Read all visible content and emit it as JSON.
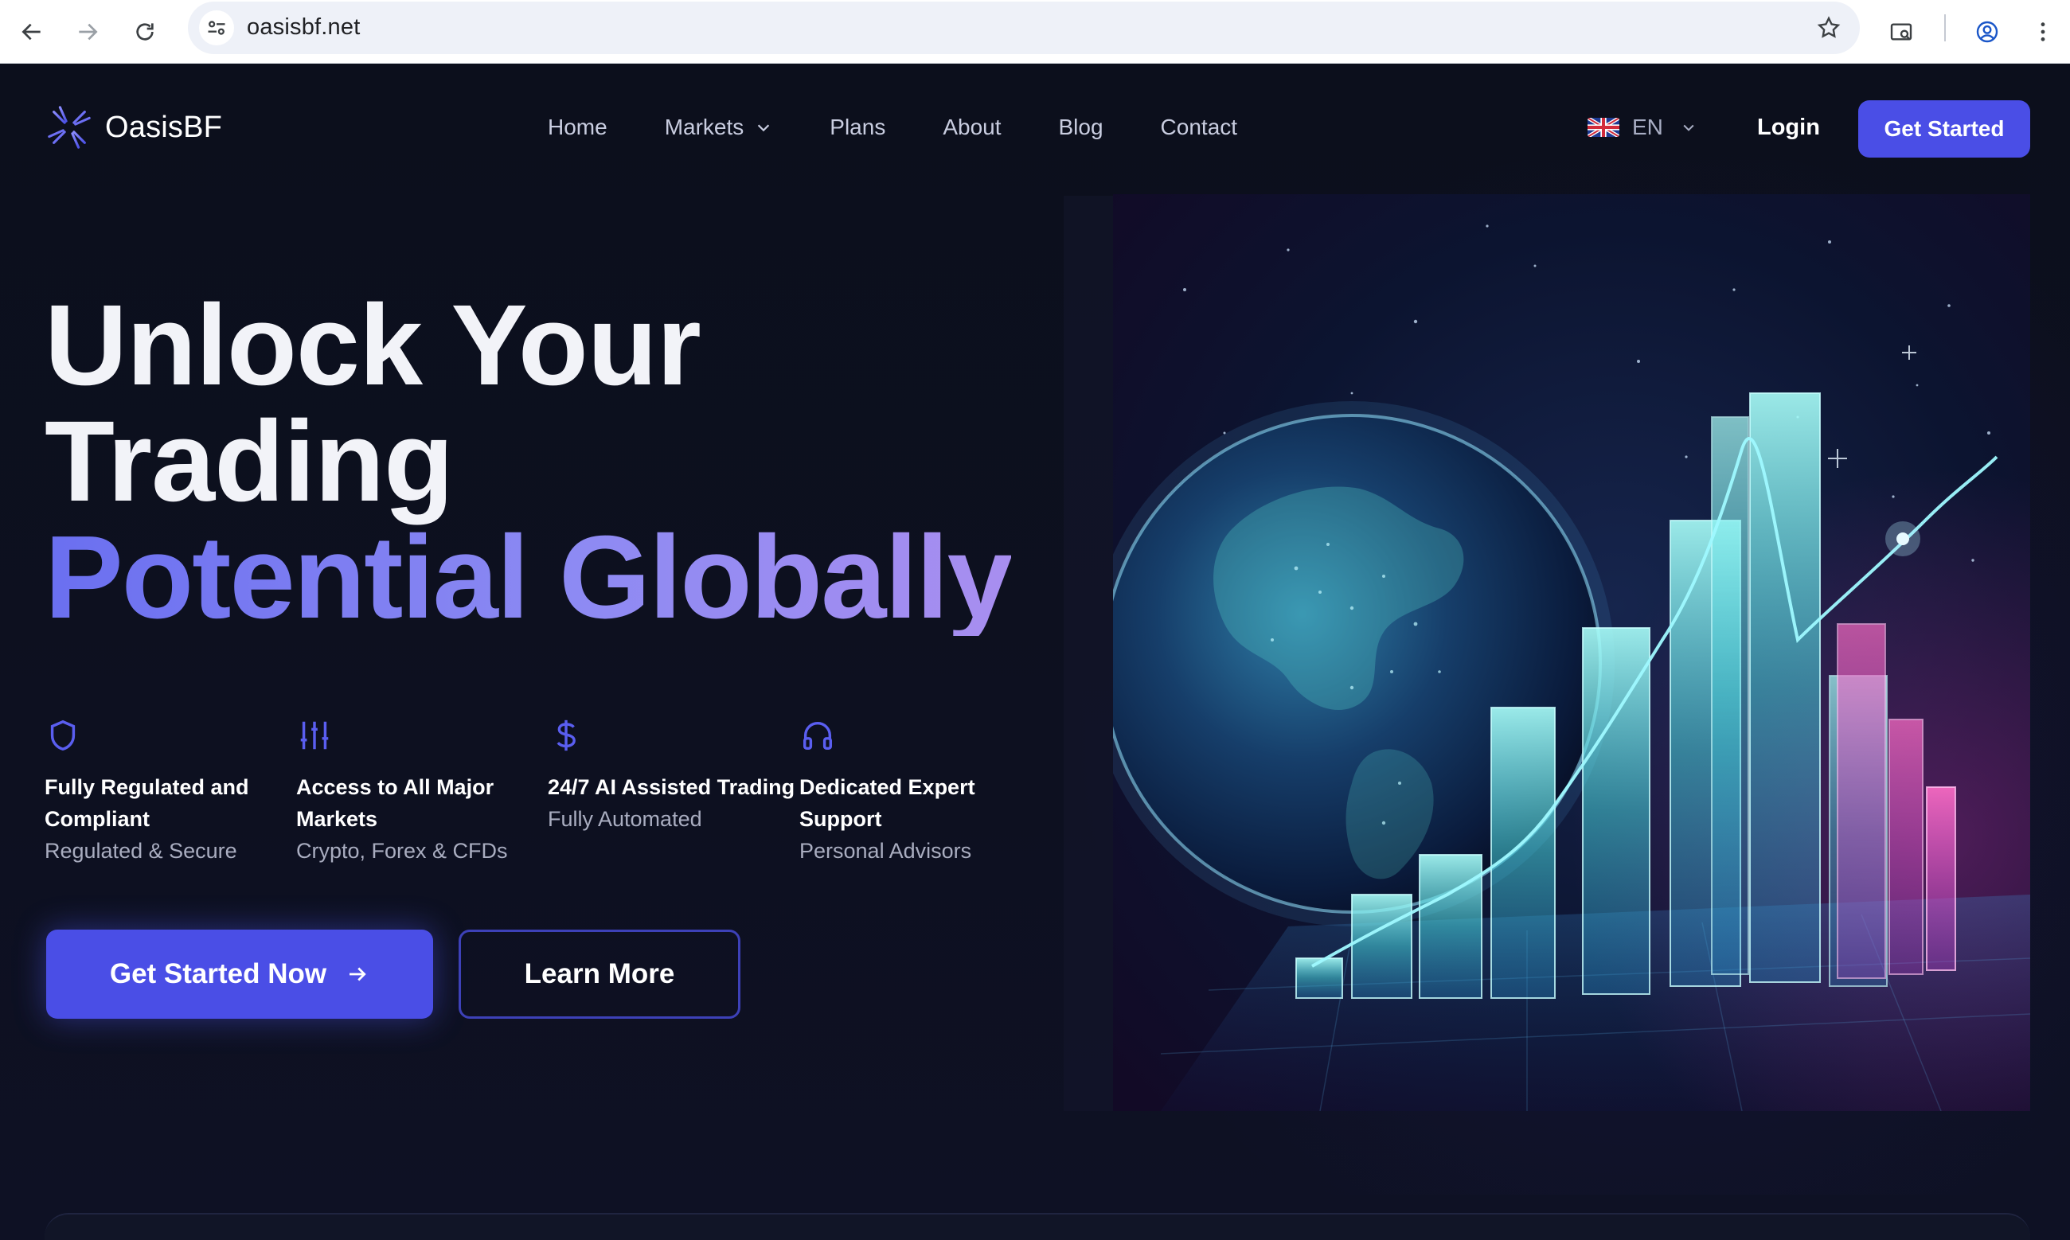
{
  "browser": {
    "url": "oasisbf.net",
    "icons": [
      "back-arrow-icon",
      "forward-arrow-icon",
      "reload-icon",
      "site-settings-icon",
      "bookmark-star-icon",
      "tab-search-icon",
      "profile-icon",
      "more-menu-icon"
    ]
  },
  "header": {
    "logo_text": "OasisBF",
    "nav": [
      {
        "label": "Home"
      },
      {
        "label": "Markets"
      },
      {
        "label": "Plans"
      },
      {
        "label": "About"
      },
      {
        "label": "Blog"
      },
      {
        "label": "Contact"
      }
    ],
    "language": "EN",
    "login_label": "Login",
    "cta_label": "Get Started"
  },
  "hero": {
    "title_line1": "Unlock Your",
    "title_line2": "Trading",
    "title_accent": "Potential Globally",
    "features": [
      {
        "icon": "shield-icon",
        "title": "Fully Regulated and Compliant",
        "subtitle": "Regulated & Secure"
      },
      {
        "icon": "sliders-icon",
        "title": "Access to All Major Markets",
        "subtitle": "Crypto, Forex & CFDs"
      },
      {
        "icon": "dollar-icon",
        "title": "24/7 AI Assisted Trading",
        "subtitle": "Fully Automated"
      },
      {
        "icon": "headphones-icon",
        "title": "Dedicated Expert Support",
        "subtitle": "Personal Advisors"
      }
    ],
    "primary_button": "Get Started Now",
    "secondary_button": "Learn More"
  },
  "colors": {
    "accent": "#4a4ee6",
    "accent_text": "#7d7ff2",
    "background": "#0c0f1c"
  }
}
